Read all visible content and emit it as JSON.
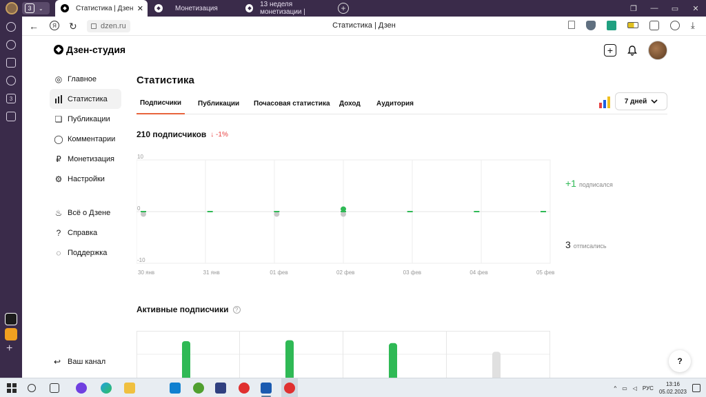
{
  "browser": {
    "tab_count": "3",
    "tabs": [
      {
        "title": "Статистика | Дзен",
        "close": "✕"
      },
      {
        "title": "Монетизация"
      },
      {
        "title": "13 неделя монетизации |"
      }
    ],
    "new_tab": "+",
    "address": "dzen.ru",
    "page_title": "Статистика | Дзен"
  },
  "header": {
    "logo": "Дзен-студия"
  },
  "nav": {
    "items": [
      {
        "label": "Главное",
        "icon": "planet-icon"
      },
      {
        "label": "Статистика",
        "icon": "bar-chart-icon"
      },
      {
        "label": "Публикации",
        "icon": "stack-icon"
      },
      {
        "label": "Комментарии",
        "icon": "comment-icon"
      },
      {
        "label": "Монетизация",
        "icon": "ruble-icon"
      },
      {
        "label": "Настройки",
        "icon": "gear-icon"
      }
    ],
    "secondary": [
      {
        "label": "Всё о Дзене",
        "icon": "flame-icon"
      },
      {
        "label": "Справка",
        "icon": "question-icon"
      },
      {
        "label": "Поддержка",
        "icon": "chat-icon"
      }
    ],
    "channel": "Ваш канал"
  },
  "main": {
    "title": "Статистика",
    "tabs": [
      "Подписчики",
      "Публикации",
      "Почасовая статистика",
      "Доход",
      "Аудитория"
    ],
    "range": "7 дней",
    "subscribers": "210 подписчиков",
    "change": "↓ -1%",
    "subscribed_value": "+1",
    "subscribed_label": "подписался",
    "unsubscribed_value": "3",
    "unsubscribed_label": "отписались",
    "active_title": "Активные подписчики",
    "help": "?"
  },
  "chart_data": [
    {
      "type": "bar",
      "categories": [
        "30 янв",
        "31 янв",
        "01 фев",
        "02 фев",
        "03 фев",
        "04 фев",
        "05 фев"
      ],
      "series": [
        {
          "name": "подписался",
          "values": [
            0,
            0,
            0,
            1,
            0,
            0,
            0
          ]
        },
        {
          "name": "отписались",
          "values": [
            -1,
            0,
            -1,
            -1,
            0,
            0,
            0
          ]
        }
      ],
      "y_ticks": [
        "10",
        "0",
        "-10"
      ],
      "ylim": [
        -10,
        10
      ],
      "colors": {
        "positive": "#2fb955",
        "negative": "#c8c8c8",
        "zero": "#2fb955"
      }
    },
    {
      "type": "bar",
      "categories": [
        "",
        "",
        "",
        ""
      ],
      "values": [
        0.9,
        0.92,
        0.86,
        0.68
      ],
      "colors": [
        "#2fb955",
        "#2fb955",
        "#2fb955",
        "#e0e0e0"
      ]
    }
  ],
  "taskbar": {
    "lang": "РУС",
    "time": "13:16",
    "date": "05.02.2023"
  }
}
